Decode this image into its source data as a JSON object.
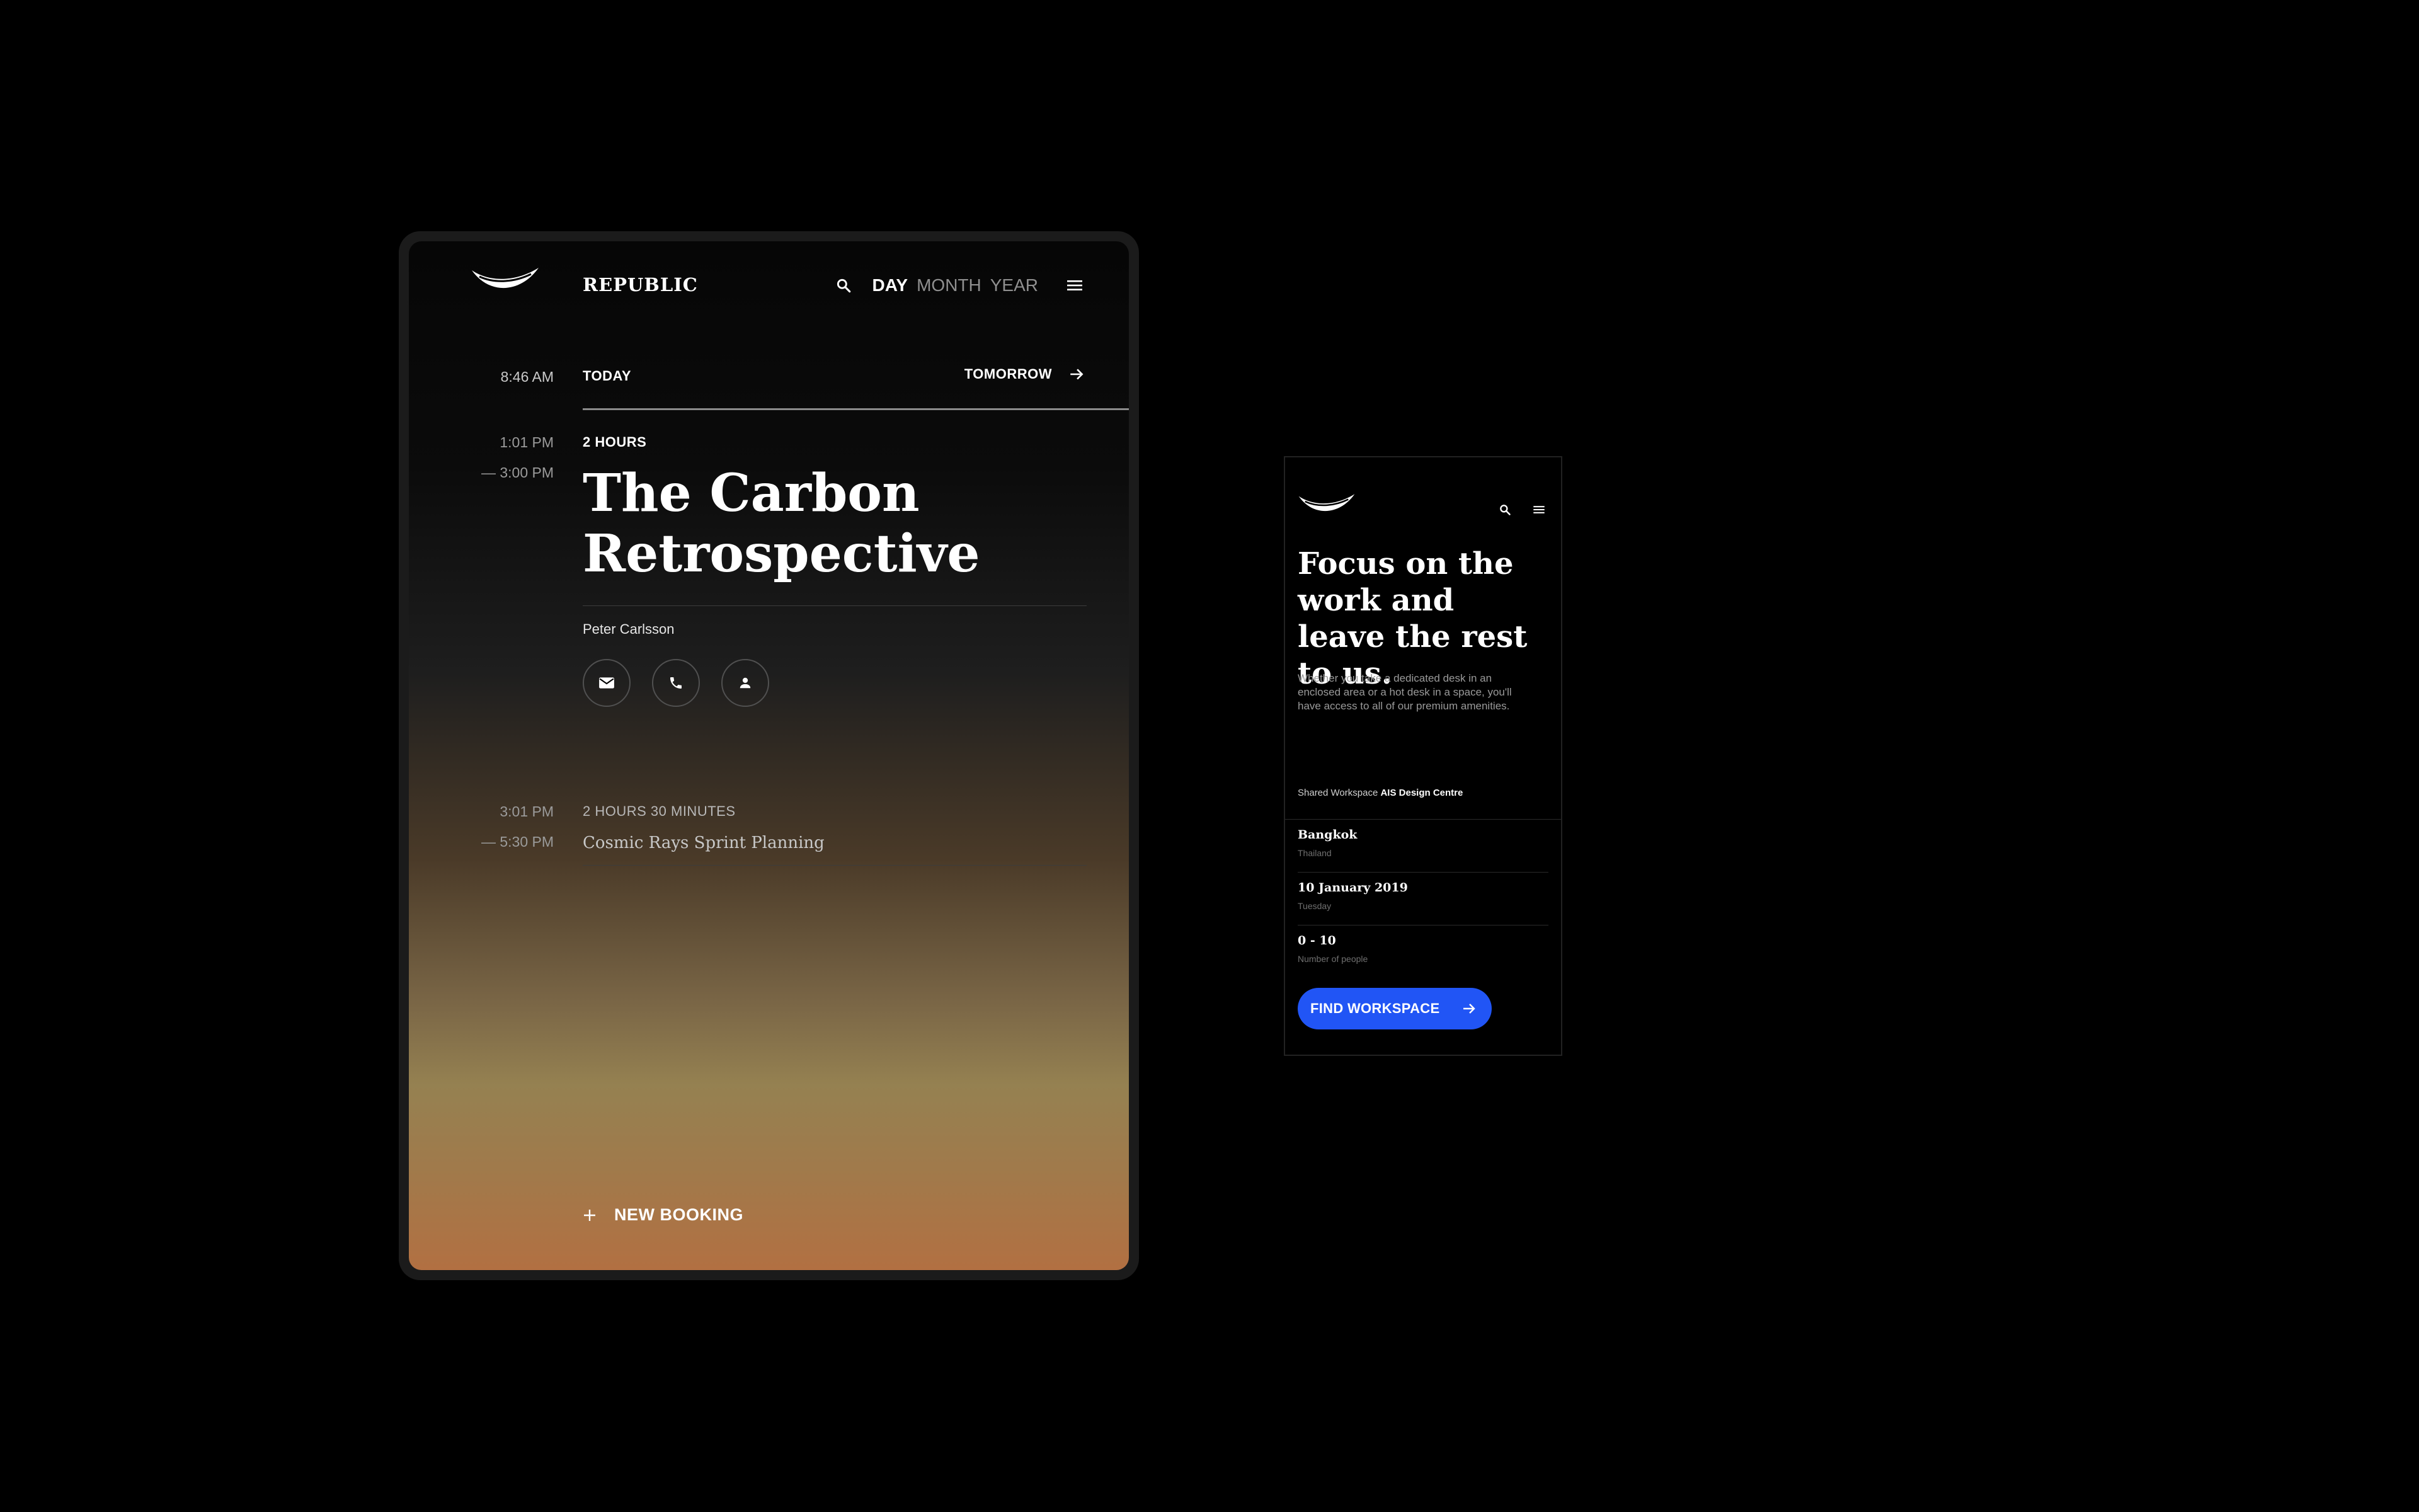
{
  "tablet": {
    "brand": "REPUBLIC",
    "nav": {
      "day": "DAY",
      "month": "MONTH",
      "year": "YEAR",
      "active": "DAY"
    },
    "current_time": "8:46 AM",
    "day_bar": {
      "today": "TODAY",
      "tomorrow": "TOMORROW"
    },
    "events": [
      {
        "start": "1:01 PM",
        "end": "— 3:00 PM",
        "duration": "2 HOURS",
        "title": "The Carbon Retrospective",
        "person": "Peter Carlsson",
        "actions": [
          "mail-icon",
          "phone-icon",
          "person-icon"
        ]
      },
      {
        "start": "3:01 PM",
        "end": "— 5:30 PM",
        "duration": "2 HOURS 30 MINUTES",
        "title": "Cosmic Rays Sprint Planning"
      }
    ],
    "new_booking": "NEW BOOKING"
  },
  "phone": {
    "headline": "Focus on the work and leave the rest to us.",
    "body": "Whether you take a dedicated desk in an enclosed area or a hot desk in a space, you'll have access to all of our premium amenities.",
    "workspace_label": "Shared Workspace",
    "workspace_name": "AIS Design Centre",
    "fields": [
      {
        "title": "Bangkok",
        "sub": "Thailand"
      },
      {
        "title": "10 January 2019",
        "sub": "Tuesday"
      },
      {
        "title": "0 - 10",
        "sub": "Number of people"
      }
    ],
    "cta": "FIND WORKSPACE"
  },
  "colors": {
    "background": "#000000",
    "accent": "#2155f5",
    "gradient_bottom": "#b27042"
  }
}
